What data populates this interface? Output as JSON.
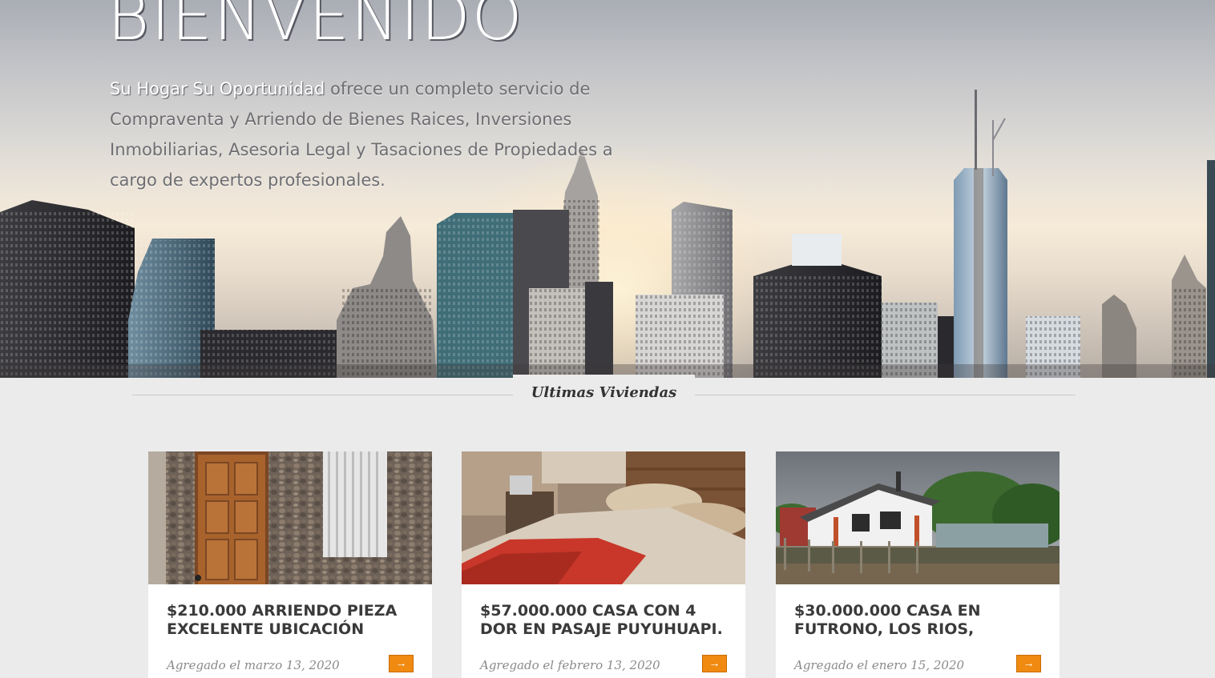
{
  "hero": {
    "title": "BIENVENIDO",
    "brand_name": "Su Hogar Su Oportunidad",
    "description": " ofrece un completo servicio de Compraventa y Arriendo de Bienes Raices, Inversiones Inmobiliarias, Asesoria Legal y Tasaciones de Propiedades a cargo de expertos profesionales."
  },
  "section": {
    "title": "Ultimas Viviendas"
  },
  "listings": [
    {
      "title": "$210.000 ARRIENDO PIEZA EXCELENTE UBICACIÓN",
      "date": "Agregado el marzo 13, 2020",
      "button_icon": "→",
      "photo": "wooden-door-stone-wall-photo"
    },
    {
      "title": "$57.000.000 CASA CON 4 DOR EN PASAJE PUYUHUAPI.",
      "date": "Agregado el febrero 13, 2020",
      "button_icon": "→",
      "photo": "bedroom-photo"
    },
    {
      "title": "$30.000.000 CASA EN FUTRONO, LOS RIOS,",
      "date": "Agregado el enero 15, 2020",
      "button_icon": "→",
      "photo": "white-house-photo"
    }
  ],
  "colors": {
    "accent": "#f08a10",
    "background": "#ebebeb",
    "card": "#ffffff"
  }
}
